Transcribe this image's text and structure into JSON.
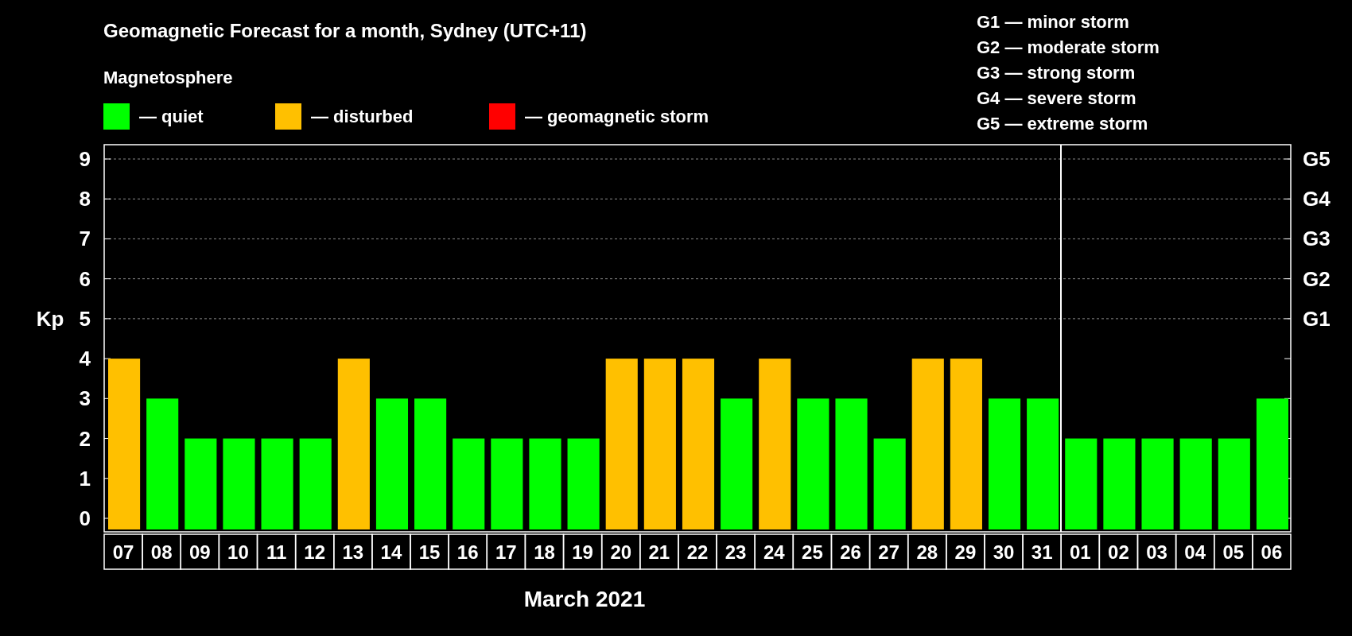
{
  "title": "Geomagnetic Forecast for a month, Sydney (UTC+11)",
  "legend_title": "Magnetosphere",
  "legend": [
    {
      "label": "— quiet",
      "color": "#00ff00"
    },
    {
      "label": "— disturbed",
      "color": "#ffc000"
    },
    {
      "label": "— geomagnetic storm",
      "color": "#ff0000"
    }
  ],
  "storm_scale": [
    "G1 — minor storm",
    "G2 — moderate storm",
    "G3 — strong storm",
    "G4 — severe storm",
    "G5 — extreme storm"
  ],
  "chart_data": {
    "type": "bar",
    "xlabel": "March 2021",
    "ylabel": "Kp",
    "categories": [
      "07",
      "08",
      "09",
      "10",
      "11",
      "12",
      "13",
      "14",
      "15",
      "16",
      "17",
      "18",
      "19",
      "20",
      "21",
      "22",
      "23",
      "24",
      "25",
      "26",
      "27",
      "28",
      "29",
      "30",
      "31",
      "01",
      "02",
      "03",
      "04",
      "05",
      "06"
    ],
    "values": [
      4,
      3,
      2,
      2,
      2,
      2,
      4,
      3,
      3,
      2,
      2,
      2,
      2,
      4,
      4,
      4,
      3,
      4,
      3,
      3,
      2,
      4,
      4,
      3,
      3,
      2,
      2,
      2,
      2,
      2,
      3
    ],
    "ylim": [
      0,
      9
    ],
    "yticks": [
      0,
      1,
      2,
      3,
      4,
      5,
      6,
      7,
      8,
      9
    ],
    "grid": true
  },
  "storm_axis_labels": [
    "G5",
    "G4",
    "G3",
    "G2",
    "G1"
  ]
}
